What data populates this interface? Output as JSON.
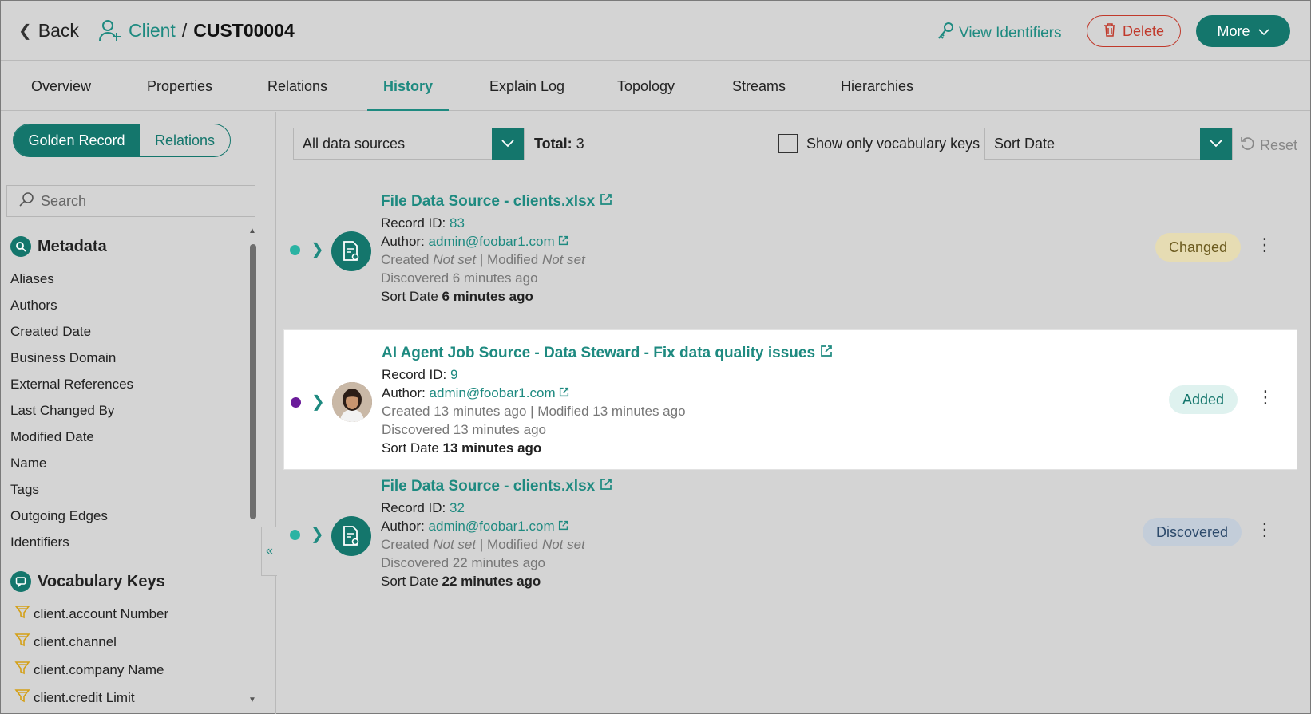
{
  "header": {
    "back_label": "Back",
    "entity_type": "Client",
    "separator": "/",
    "entity_code": "CUST00004",
    "view_identifiers": "View Identifiers",
    "delete_label": "Delete",
    "more_label": "More"
  },
  "tabs": [
    {
      "label": "Overview"
    },
    {
      "label": "Properties"
    },
    {
      "label": "Relations"
    },
    {
      "label": "History"
    },
    {
      "label": "Explain Log"
    },
    {
      "label": "Topology"
    },
    {
      "label": "Streams"
    },
    {
      "label": "Hierarchies"
    }
  ],
  "active_tab": "History",
  "sidebar": {
    "segment": {
      "golden": "Golden Record",
      "relations": "Relations"
    },
    "search_placeholder": "Search",
    "metadata_title": "Metadata",
    "metadata_items": [
      "Aliases",
      "Authors",
      "Created Date",
      "Business Domain",
      "External References",
      "Last Changed By",
      "Modified Date",
      "Name",
      "Tags",
      "Outgoing Edges",
      "Identifiers"
    ],
    "vocab_title": "Vocabulary Keys",
    "vocab_items": [
      "client.account Number",
      "client.channel",
      "client.company Name",
      "client.credit Limit"
    ]
  },
  "toolbar": {
    "source_filter": "All data sources",
    "total_label": "Total:",
    "total_value": "3",
    "vocab_only_label": "Show only vocabulary keys",
    "sort_value": "Sort Date",
    "reset_label": "Reset"
  },
  "records": [
    {
      "title": "File Data Source - clients.xlsx",
      "record_id_label": "Record ID:",
      "record_id": "83",
      "author_label": "Author:",
      "author": "admin@foobar1.com",
      "created_label": "Created",
      "created": "Not set",
      "modified_label": "| Modified",
      "modified": "Not set",
      "discovered": "Discovered 6 minutes ago",
      "sort_label": "Sort Date",
      "sort_value": "6 minutes ago",
      "status": "Changed",
      "dot_color": "#2ab3a3",
      "badge_bg": "#e6dcb3",
      "badge_fg": "#6b5a1e"
    },
    {
      "title": "AI Agent Job Source - Data Steward - Fix data quality issues",
      "record_id_label": "Record ID:",
      "record_id": "9",
      "author_label": "Author:",
      "author": "admin@foobar1.com",
      "created_line": "Created 13 minutes ago | Modified 13 minutes ago",
      "discovered": "Discovered 13 minutes ago",
      "sort_label": "Sort Date",
      "sort_value": "13 minutes ago",
      "status": "Added",
      "dot_color": "#6a1b9a",
      "badge_bg": "#dff2ef",
      "badge_fg": "#14766c"
    },
    {
      "title": "File Data Source - clients.xlsx",
      "record_id_label": "Record ID:",
      "record_id": "32",
      "author_label": "Author:",
      "author": "admin@foobar1.com",
      "created_label": "Created",
      "created": "Not set",
      "modified_label": "| Modified",
      "modified": "Not set",
      "discovered": "Discovered 22 minutes ago",
      "sort_label": "Sort Date",
      "sort_value": "22 minutes ago",
      "status": "Discovered",
      "dot_color": "#2ab3a3",
      "badge_bg": "#c3cdd9",
      "badge_fg": "#2d4a6b"
    }
  ],
  "colors": {
    "accent": "#14766c",
    "danger": "#c0392b",
    "link": "#1e8a80"
  }
}
